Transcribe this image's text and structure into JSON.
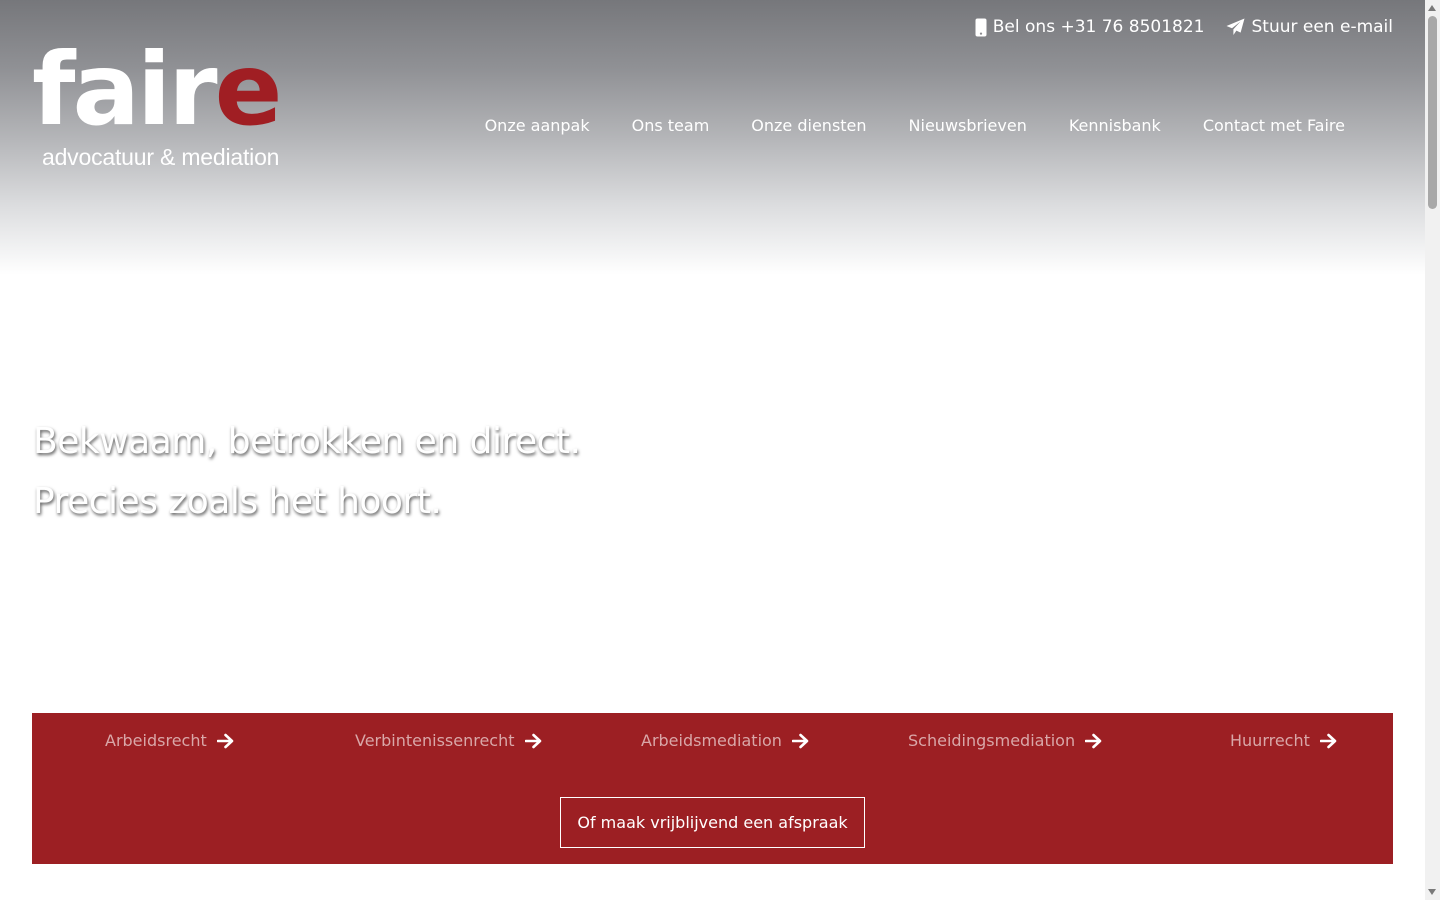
{
  "topbar": {
    "phone_icon": "mobile-phone-icon",
    "phone_label": "Bel ons +31 76 8501821",
    "email_icon": "paper-plane-icon",
    "email_label": "Stuur een e-mail"
  },
  "logo": {
    "word_main": "fair",
    "word_accent": "e",
    "subtitle": "advocatuur & mediation"
  },
  "nav": {
    "items": [
      {
        "label": "Onze aanpak"
      },
      {
        "label": "Ons team"
      },
      {
        "label": "Onze diensten"
      },
      {
        "label": "Nieuwsbrieven"
      },
      {
        "label": "Kennisbank"
      },
      {
        "label": "Contact met Faire"
      }
    ]
  },
  "hero": {
    "line1": "Bekwaam, betrokken en direct.",
    "line2": "Precies zoals het hoort."
  },
  "services": {
    "arrow_icon": "arrow-right-icon",
    "items": [
      {
        "label": "Arbeidsrecht"
      },
      {
        "label": "Verbintenissenrecht"
      },
      {
        "label": "Arbeidsmediation"
      },
      {
        "label": "Scheidingsmediation"
      },
      {
        "label": "Huurrecht"
      }
    ]
  },
  "cta": {
    "label": "Of maak vrijblijvend een afspraak"
  },
  "colors": {
    "brand_red": "#9c1f23",
    "logo_red": "#a01e23",
    "service_text": "#d9a7a8",
    "header_gray": "#76777b"
  }
}
